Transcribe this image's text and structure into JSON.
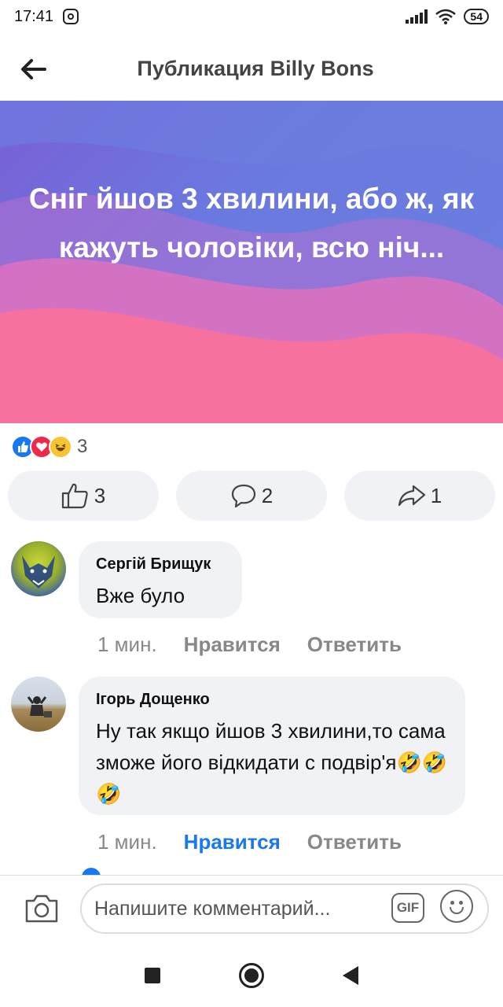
{
  "status_bar": {
    "time": "17:41",
    "battery": "54"
  },
  "header": {
    "title": "Публикация Billy Bons"
  },
  "post": {
    "text": "Сніг йшов 3 хвилини, або ж, як кажуть чоловіки, всю ніч..."
  },
  "reactions": {
    "count": "3"
  },
  "actions": {
    "likes": "3",
    "comments": "2",
    "shares": "1"
  },
  "comments": [
    {
      "author": "Сергій Брищук",
      "text": "Вже було",
      "time": "1 мин.",
      "like_label": "Нравится",
      "reply_label": "Ответить"
    },
    {
      "author": "Ігорь Дощенко",
      "text": "Ну так якщо йшов 3 хвилини,то сама зможе його відкидати с подвір'я🤣🤣🤣",
      "time": "1 мин.",
      "like_label": "Нравится",
      "reply_label": "Ответить",
      "liked": true
    }
  ],
  "composer": {
    "placeholder": "Напишите комментарий...",
    "gif_label": "GIF"
  },
  "colors": {
    "brand": "#1877f2",
    "bubble": "#f0f2f5"
  }
}
